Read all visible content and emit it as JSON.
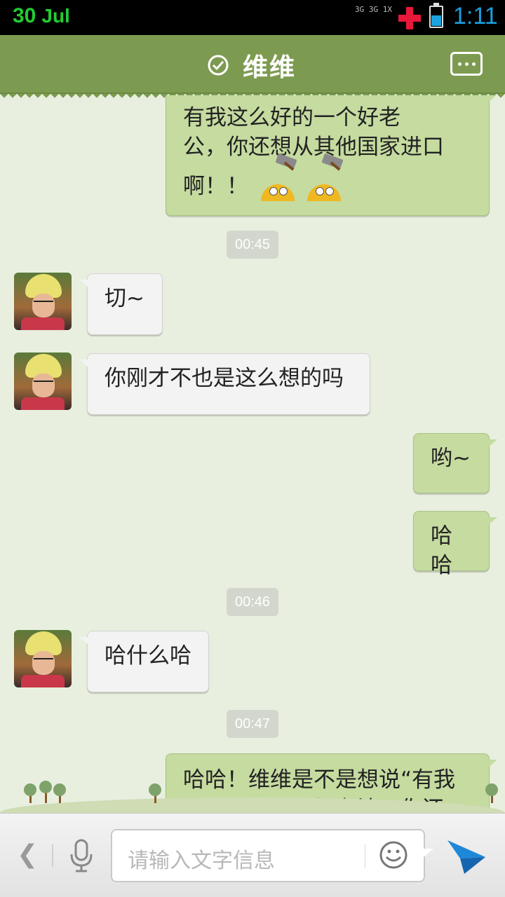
{
  "status_bar": {
    "day": "30",
    "month": "Jul",
    "network_label": "3G 3G 1X",
    "time": "1:11",
    "battery_level": 0.55,
    "colors": {
      "date": "#22cc33",
      "time": "#1a9ee0",
      "battery": "#1aa3e0",
      "alert": "#e8183a"
    }
  },
  "header": {
    "title": "维维",
    "verified_icon": "check-circle-icon",
    "more_icon": "more-dots-icon",
    "background": "#7d9b50"
  },
  "messages": [
    {
      "side": "me",
      "lines": [
        "有我这么好的一个好老",
        "公，你还想从其他国家进口",
        "啊！！"
      ],
      "emoji": [
        "hammer-emoji",
        "hammer-emoji"
      ]
    },
    {
      "type": "time",
      "text": "00:45"
    },
    {
      "side": "them",
      "text": "切~"
    },
    {
      "side": "them",
      "text": "你刚才不也是这么想的吗"
    },
    {
      "side": "me",
      "text": "哟~"
    },
    {
      "side": "me",
      "text": "哈哈"
    },
    {
      "type": "time",
      "text": "00:46"
    },
    {
      "side": "them",
      "text": "哈什么哈"
    },
    {
      "type": "time",
      "text": "00:47"
    },
    {
      "side": "me",
      "lines": [
        "哈哈！维维是不是想说“有我",
        "这么好的一个好老婆，你还"
      ]
    }
  ],
  "input_bar": {
    "back_icon": "chevron-left-icon",
    "mic_icon": "microphone-icon",
    "placeholder": "请输入文字信息",
    "emoji_icon": "smiley-icon",
    "send_icon": "send-arrow-icon",
    "send_color": "#1e88d8"
  }
}
